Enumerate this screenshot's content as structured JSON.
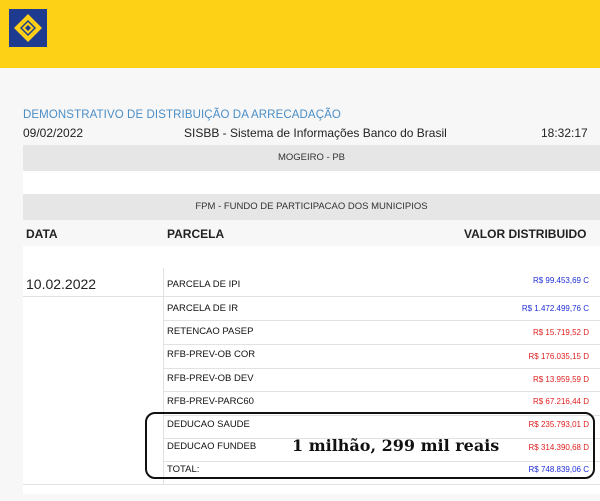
{
  "header": {
    "logo": "banco-do-brasil-logo",
    "brand_color": "#fcd116"
  },
  "report": {
    "title": "DEMONSTRATIVO DE DISTRIBUIÇÃO DA ARRECADAÇÃO",
    "date": "09/02/2022",
    "system": "SISBB - Sistema de Informações Banco do Brasil",
    "time": "18:32:17",
    "municipality": "MOGEIRO - PB",
    "fund": "FPM - FUNDO DE PARTICIPACAO DOS MUNICIPIOS"
  },
  "table": {
    "columns": {
      "date": "DATA",
      "parcel": "PARCELA",
      "value": "VALOR DISTRIBUIDO"
    },
    "date_value": "10.02.2022",
    "rows": [
      {
        "label": "PARCELA DE IPI",
        "value": "R$ 99.453,69 C",
        "color": "blue"
      },
      {
        "label": "PARCELA DE IR",
        "value": "R$ 1.472.499,76 C",
        "color": "blue"
      },
      {
        "label": "RETENCAO PASEP",
        "value": "R$ 15.719,52 D",
        "color": "red"
      },
      {
        "label": "RFB-PREV-OB COR",
        "value": "R$ 176.035,15 D",
        "color": "red"
      },
      {
        "label": "RFB-PREV-OB DEV",
        "value": "R$ 13.959,59 D",
        "color": "red"
      },
      {
        "label": "RFB-PREV-PARC60",
        "value": "R$ 67.216,44 D",
        "color": "red"
      },
      {
        "label": "DEDUCAO SAUDE",
        "value": "R$ 235.793,01 D",
        "color": "red"
      },
      {
        "label": "DEDUCAO FUNDEB",
        "value": "R$ 314.390,68 D",
        "color": "red"
      },
      {
        "label": "TOTAL:",
        "value": "R$ 748.839,06 C",
        "color": "blue"
      }
    ]
  },
  "annotation": {
    "text": "1 milhão, 299 mil reais"
  }
}
